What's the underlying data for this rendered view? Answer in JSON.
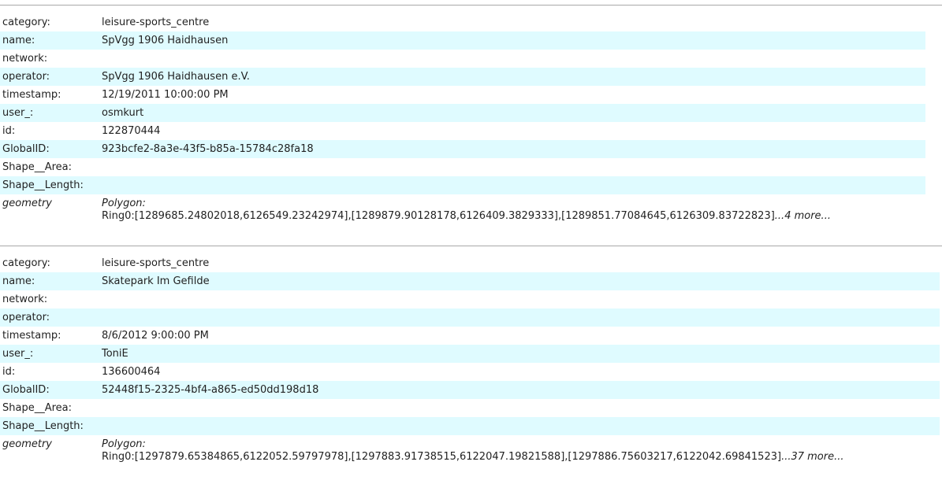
{
  "records": [
    {
      "fields": [
        {
          "key": "category:",
          "value": "leisure-sports_centre"
        },
        {
          "key": "name:",
          "value": "SpVgg 1906 Haidhausen"
        },
        {
          "key": "network:",
          "value": ""
        },
        {
          "key": "operator:",
          "value": "SpVgg 1906 Haidhausen e.V."
        },
        {
          "key": "timestamp:",
          "value": "12/19/2011 10:00:00 PM"
        },
        {
          "key": "user_:",
          "value": "osmkurt"
        },
        {
          "key": "id:",
          "value": "122870444"
        },
        {
          "key": "GlobalID:",
          "value": "923bcfe2-8a3e-43f5-b85a-15784c28fa18"
        },
        {
          "key": "Shape__Area:",
          "value": ""
        },
        {
          "key": "Shape__Length:",
          "value": ""
        }
      ],
      "geometry": {
        "key": "geometry",
        "type": "Polygon:",
        "ring": "Ring0:[1289685.24802018,6126549.23242974],[1289879.90128178,6126409.3829333],[1289851.77084645,6126309.83722823]",
        "more": "...4 more..."
      }
    },
    {
      "fields": [
        {
          "key": "category:",
          "value": "leisure-sports_centre"
        },
        {
          "key": "name:",
          "value": "Skatepark Im Gefilde"
        },
        {
          "key": "network:",
          "value": ""
        },
        {
          "key": "operator:",
          "value": ""
        },
        {
          "key": "timestamp:",
          "value": "8/6/2012 9:00:00 PM"
        },
        {
          "key": "user_:",
          "value": "ToniE"
        },
        {
          "key": "id:",
          "value": "136600464"
        },
        {
          "key": "GlobalID:",
          "value": "52448f15-2325-4bf4-a865-ed50dd198d18"
        },
        {
          "key": "Shape__Area:",
          "value": ""
        },
        {
          "key": "Shape__Length:",
          "value": ""
        }
      ],
      "geometry": {
        "key": "geometry",
        "type": "Polygon:",
        "ring": "Ring0:[1297879.65384865,6122052.59797978],[1297883.91738515,6122047.19821588],[1297886.75603217,6122042.69841523]",
        "more": "...37 more..."
      }
    }
  ]
}
